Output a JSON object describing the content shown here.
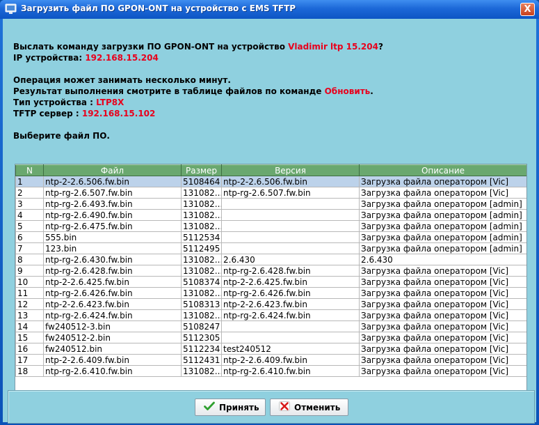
{
  "window": {
    "title": "Загрузить файл ПО GPON-ONT на устройство с EMS TFTP",
    "close_label": "X"
  },
  "info": {
    "line1_prefix": "Выслать команду загрузки ПО GPON-ONT на устройство ",
    "device_name": "Vladimir ltp 15.204",
    "line1_suffix": "?",
    "ip_label": "IP устройства: ",
    "ip_value": "192.168.15.204",
    "op_notice": "Операция может занимать несколько минут.",
    "result_prefix": "Результат выполнения смотрите в таблице файлов по команде ",
    "result_link": "Обновить",
    "result_suffix": ".",
    "type_label": "Тип устройства : ",
    "type_value": "LTP8X",
    "tftp_label": "TFTP сервер : ",
    "tftp_value": "192.168.15.102",
    "choose": "Выберите файл ПО."
  },
  "table": {
    "columns": [
      "N",
      "Файл",
      "Размер",
      "Версия",
      "Описание"
    ],
    "rows": [
      [
        "1",
        "ntp-2-2.6.506.fw.bin",
        "5108464",
        "ntp-2-2.6.506.fw.bin",
        "Загрузка файла оператором [Vic]"
      ],
      [
        "2",
        "ntp-rg-2.6.507.fw.bin",
        "131082...",
        "ntp-rg-2.6.507.fw.bin",
        "Загрузка файла оператором [Vic]"
      ],
      [
        "3",
        "ntp-rg-2.6.493.fw.bin",
        "131082...",
        "",
        "Загрузка файла оператором [admin]"
      ],
      [
        "4",
        "ntp-rg-2.6.490.fw.bin",
        "131082...",
        "",
        "Загрузка файла оператором [admin]"
      ],
      [
        "5",
        "ntp-rg-2.6.475.fw.bin",
        "131082...",
        "",
        "Загрузка файла оператором [admin]"
      ],
      [
        "6",
        "555.bin",
        "5112534",
        "",
        "Загрузка файла оператором [admin]"
      ],
      [
        "7",
        "123.bin",
        "5112495",
        "",
        "Загрузка файла оператором [admin]"
      ],
      [
        "8",
        "ntp-rg-2.6.430.fw.bin",
        "131082...",
        "2.6.430",
        "2.6.430"
      ],
      [
        "9",
        "ntp-rg-2.6.428.fw.bin",
        "131082...",
        "ntp-rg-2.6.428.fw.bin",
        "Загрузка файла оператором [Vic]"
      ],
      [
        "10",
        "ntp-2-2.6.425.fw.bin",
        "5108374",
        "ntp-2-2.6.425.fw.bin",
        "Загрузка файла оператором [Vic]"
      ],
      [
        "11",
        "ntp-rg-2.6.426.fw.bin",
        "131082...",
        "ntp-rg-2.6.426.fw.bin",
        "Загрузка файла оператором [Vic]"
      ],
      [
        "12",
        "ntp-2-2.6.423.fw.bin",
        "5108313",
        "ntp-2-2.6.423.fw.bin",
        "Загрузка файла оператором [Vic]"
      ],
      [
        "13",
        "ntp-rg-2.6.424.fw.bin",
        "131082...",
        "ntp-rg-2.6.424.fw.bin",
        "Загрузка файла оператором [Vic]"
      ],
      [
        "14",
        "fw240512-3.bin",
        "5108247",
        "",
        "Загрузка файла оператором [Vic]"
      ],
      [
        "15",
        "fw240512-2.bin",
        "5112305",
        "",
        "Загрузка файла оператором [Vic]"
      ],
      [
        "16",
        "fw240512.bin",
        "5112234",
        "test240512",
        "Загрузка файла оператором [Vic]"
      ],
      [
        "17",
        "ntp-2-2.6.409.fw.bin",
        "5112431",
        "ntp-2-2.6.409.fw.bin",
        "Загрузка файла оператором [Vic]"
      ],
      [
        "18",
        "ntp-rg-2.6.410.fw.bin",
        "131082...",
        "ntp-rg-2.6.410.fw.bin",
        "Загрузка файла оператором [Vic]"
      ]
    ],
    "selected_row": 0
  },
  "buttons": {
    "accept": "Принять",
    "cancel": "Отменить"
  },
  "colors": {
    "accent_red": "#e8001c",
    "header_green": "#6aa86f",
    "client_bg": "#8fd0df",
    "selected_row": "#bcd2ea"
  },
  "icons": {
    "title": "window-app-icon",
    "accept": "checkmark-icon",
    "cancel": "cross-icon"
  }
}
